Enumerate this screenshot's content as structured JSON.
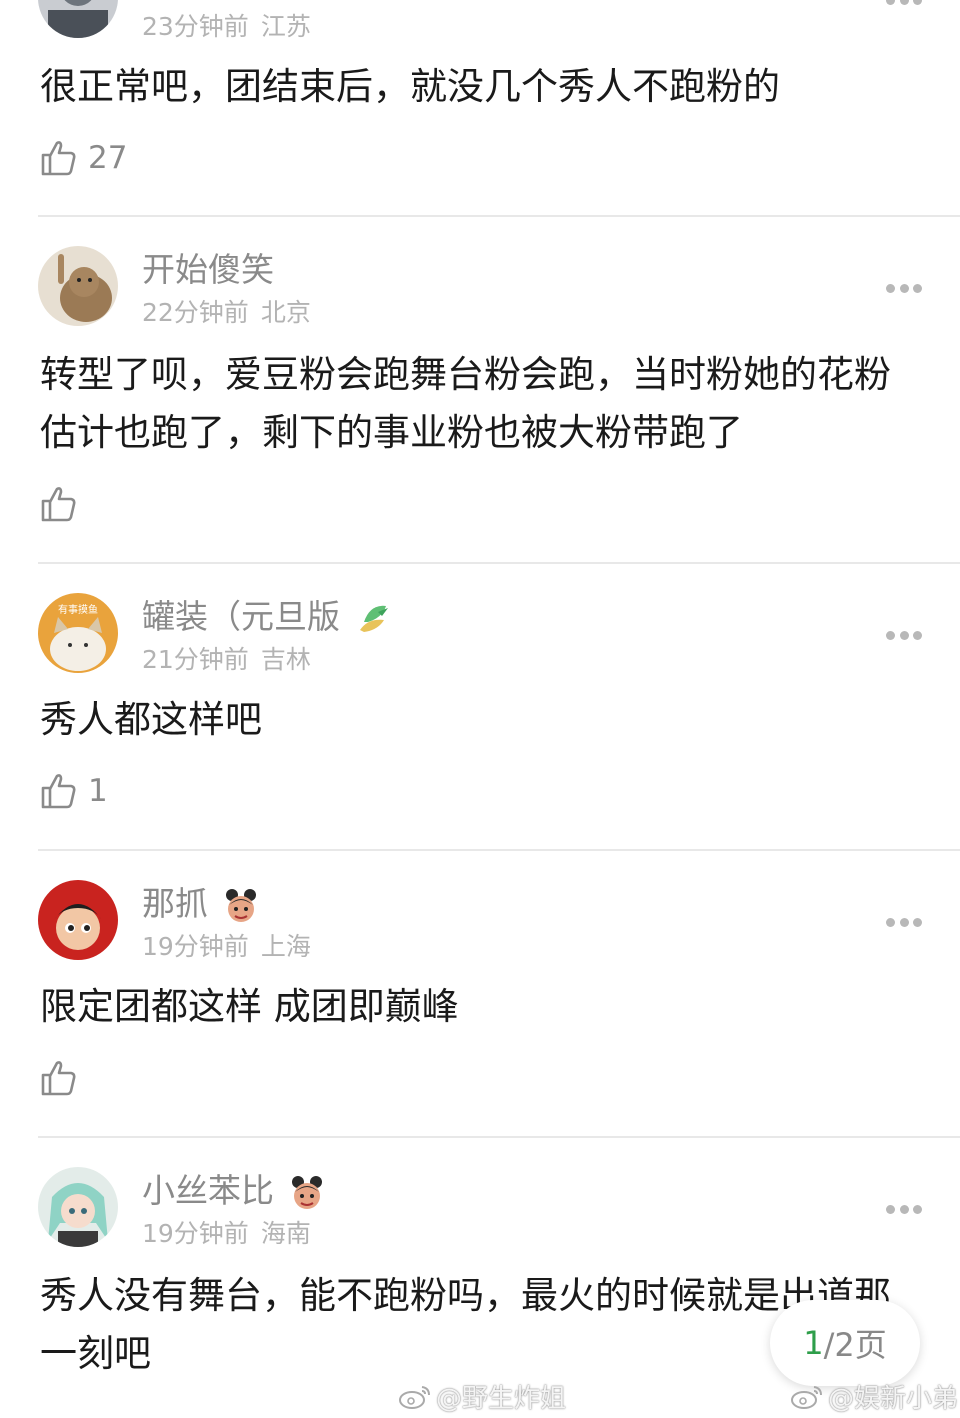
{
  "comments": [
    {
      "time": "23分钟前",
      "location": "江苏",
      "text": "很正常吧，团结束后，就没几个秀人不跑粉的",
      "likes": "27"
    },
    {
      "username": "开始傻笑",
      "time": "22分钟前",
      "location": "北京",
      "text": "转型了呗，爱豆粉会跑舞台粉会跑，当时粉她的花粉估计也跑了，剩下的事业粉也被大粉带跑了",
      "likes": ""
    },
    {
      "username": "罐装（元旦版",
      "time": "21分钟前",
      "location": "吉林",
      "text": "秀人都这样吧",
      "likes": "1",
      "avatar_caption": "有事摸鱼"
    },
    {
      "username": "那抓",
      "time": "19分钟前",
      "location": "上海",
      "text": "限定团都这样 成团即巅峰",
      "likes": ""
    },
    {
      "username": "小丝苯比",
      "time": "19分钟前",
      "location": "海南",
      "text": "秀人没有舞台，能不跑粉吗，最火的时候就是出道那一刻吧"
    }
  ],
  "pager": {
    "current": "1",
    "total_label": "/2页"
  },
  "watermarks": [
    "@野生炸姐",
    "@娱新小弟"
  ],
  "colors": {
    "accent": "#2e9e4a",
    "meta": "#b3b3b3",
    "username": "#8a8a8a"
  }
}
